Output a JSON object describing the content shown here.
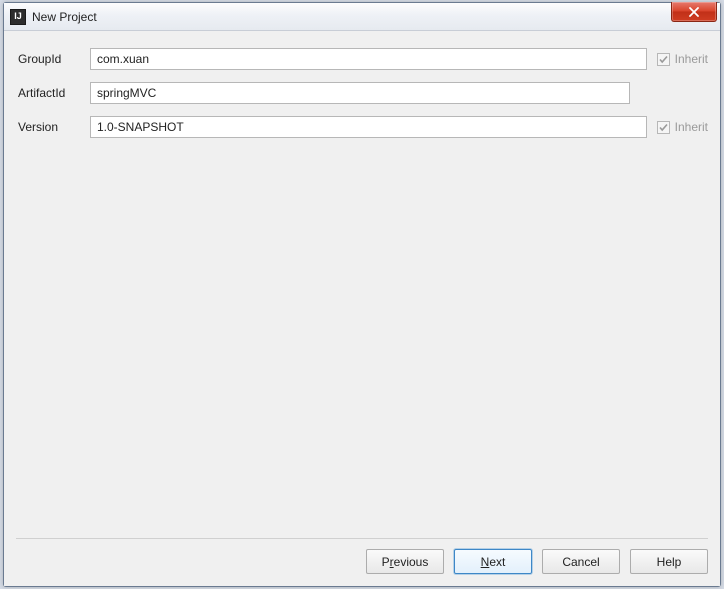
{
  "window": {
    "title": "New Project",
    "app_icon_text": "IJ"
  },
  "form": {
    "groupid_label": "GroupId",
    "groupid_value": "com.xuan",
    "artifactid_label": "ArtifactId",
    "artifactid_value": "springMVC",
    "version_label": "Version",
    "version_value": "1.0-SNAPSHOT",
    "inherit_label": "Inherit"
  },
  "buttons": {
    "previous_pre": "P",
    "previous_mn": "r",
    "previous_post": "evious",
    "next_pre": "",
    "next_mn": "N",
    "next_post": "ext",
    "cancel": "Cancel",
    "help": "Help"
  }
}
